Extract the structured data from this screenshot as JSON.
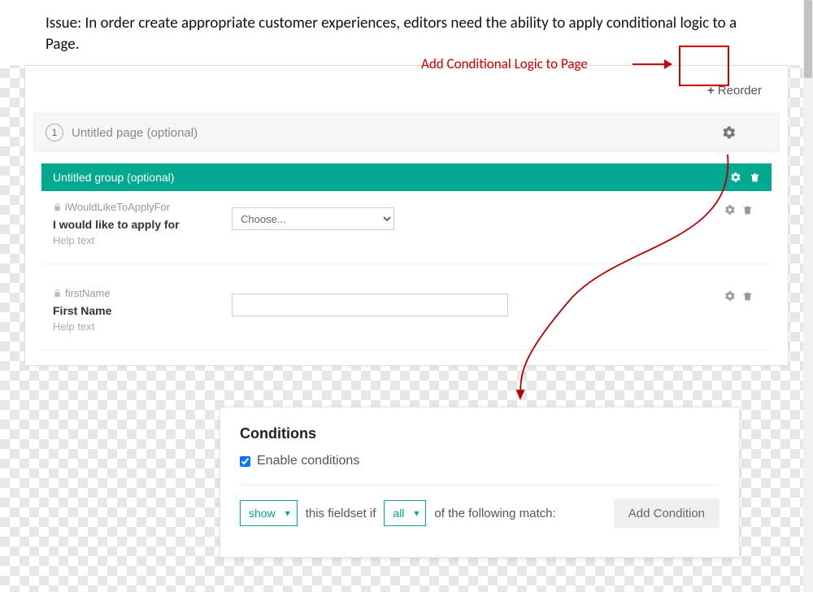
{
  "issue_text": "Issue: In order create appropriate customer experiences, editors need the ability to apply conditional logic to a Page.",
  "annotation": {
    "add_logic_label": "Add Conditional Logic to Page"
  },
  "editor": {
    "reorder_label": "Reorder",
    "page": {
      "number": "1",
      "title": "Untitled page (optional)"
    },
    "group": {
      "title": "Untitled group (optional)"
    },
    "fields": [
      {
        "id": "iWouldLikeToApplyFor",
        "label": "I would like to apply for",
        "help": "Help text",
        "select_placeholder": "Choose..."
      },
      {
        "id": "firstName",
        "label": "First Name",
        "help": "Help text"
      }
    ]
  },
  "conditions": {
    "title": "Conditions",
    "enable_label": "Enable conditions",
    "enable_checked": true,
    "action_value": "show",
    "mid_text": "this fieldset if",
    "match_value": "all",
    "tail_text": "of the following match:",
    "add_button": "Add Condition"
  }
}
